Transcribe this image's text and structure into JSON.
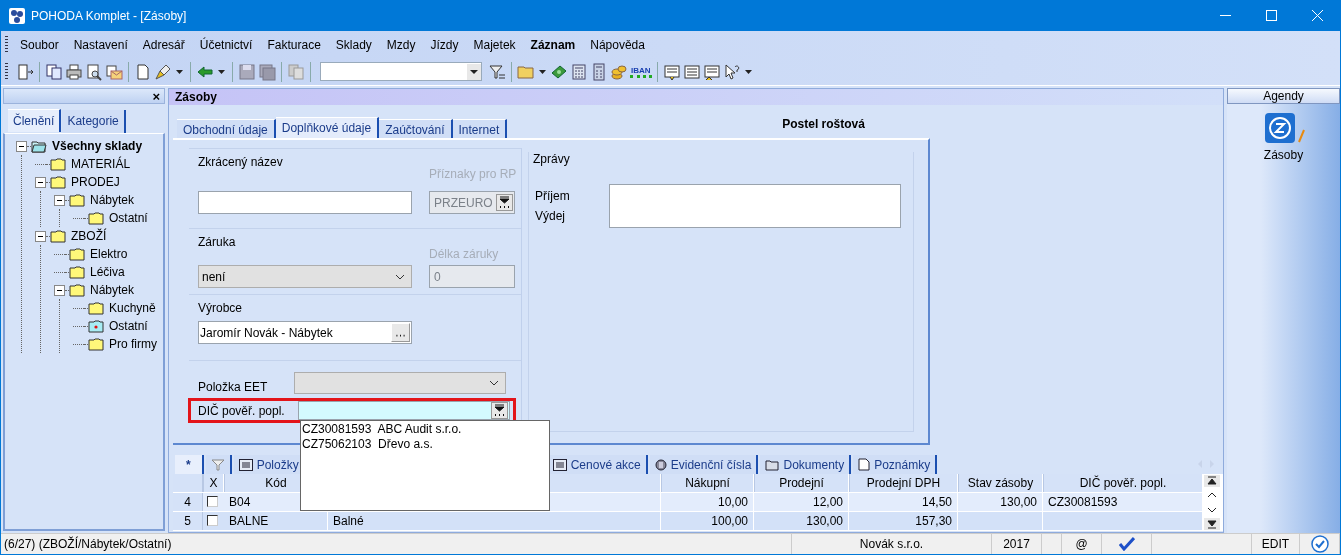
{
  "window": {
    "title": "POHODA Komplet - [Zásoby]"
  },
  "menu": [
    {
      "label": "Soubor",
      "bold": false
    },
    {
      "label": "Nastavení",
      "bold": false
    },
    {
      "label": "Adresář",
      "bold": false
    },
    {
      "label": "Účetnictví",
      "bold": false
    },
    {
      "label": "Fakturace",
      "bold": false
    },
    {
      "label": "Sklady",
      "bold": false
    },
    {
      "label": "Mzdy",
      "bold": false
    },
    {
      "label": "Jízdy",
      "bold": false
    },
    {
      "label": "Majetek",
      "bold": false
    },
    {
      "label": "Záznam",
      "bold": true
    },
    {
      "label": "Nápověda",
      "bold": false
    }
  ],
  "toolbar": {
    "iban_label": "IBAN"
  },
  "left_panel": {
    "close": "×",
    "tabs": [
      {
        "label": "Členění",
        "selected": true
      },
      {
        "label": "Kategorie",
        "selected": false
      }
    ],
    "tree": [
      {
        "label": "Všechny sklady",
        "selected": false,
        "expanded": true,
        "children": [
          {
            "label": "MATERIÁL",
            "selected": false
          },
          {
            "label": "PRODEJ",
            "selected": false,
            "expanded": true,
            "children": [
              {
                "label": "Nábytek",
                "selected": false,
                "expanded": true,
                "children": [
                  {
                    "label": "Ostatní",
                    "selected": false
                  }
                ]
              }
            ]
          },
          {
            "label": "ZBOŽÍ",
            "selected": false,
            "expanded": true,
            "children": [
              {
                "label": "Elektro",
                "selected": false
              },
              {
                "label": "Léčiva",
                "selected": false
              },
              {
                "label": "Nábytek",
                "selected": false,
                "expanded": true,
                "children": [
                  {
                    "label": "Kuchyně",
                    "selected": false
                  },
                  {
                    "label": "Ostatní",
                    "selected": true
                  },
                  {
                    "label": "Pro firmy",
                    "selected": false
                  }
                ]
              }
            ]
          }
        ]
      }
    ]
  },
  "agenda": {
    "title": "Zásoby",
    "item_name": "Postel roštová",
    "tabs": [
      {
        "label": "Obchodní údaje",
        "selected": false
      },
      {
        "label": "Doplňkové údaje",
        "selected": true
      },
      {
        "label": "Zaúčtování",
        "selected": false
      },
      {
        "label": "Internet",
        "selected": false
      }
    ],
    "short_name": {
      "label": "Zkrácený název"
    },
    "rp_flags": {
      "label": "Příznaky pro RP",
      "value": "PRZEURO",
      "disabled": true
    },
    "warranty": {
      "label": "Záruka",
      "value": "není"
    },
    "warranty_length": {
      "label": "Délka záruky",
      "value": "0",
      "disabled": true
    },
    "manufacturer": {
      "label": "Výrobce",
      "value": "Jaromír Novák - Nábytek"
    },
    "eet_item": {
      "label": "Položka EET",
      "disabled": true
    },
    "vat_payer": {
      "label": "DIČ pověř. popl.",
      "highlighted": true,
      "open": true,
      "options": [
        {
          "code": "CZ30081593",
          "name": "ABC Audit s.r.o."
        },
        {
          "code": "CZ75062103",
          "name": "Dřevo a.s."
        }
      ]
    },
    "messages": {
      "label": "Zprávy",
      "receipt": "Příjem",
      "issue": "Výdej"
    },
    "bottom_tabs_left": [
      {
        "label": "*",
        "kind": "new",
        "selected": true
      },
      {
        "kind": "filter",
        "selected": false
      },
      {
        "label": "Položky",
        "kind": "list",
        "selected": false
      }
    ],
    "bottom_tabs_right": [
      {
        "label": "Cenové akce",
        "kind": "list",
        "selected": false
      },
      {
        "label": "Evidenční čísla",
        "kind": "badge",
        "selected": false
      },
      {
        "label": "Dokumenty",
        "kind": "folder",
        "selected": false
      },
      {
        "label": "Poznámky",
        "kind": "note",
        "selected": false
      }
    ],
    "grid": {
      "check_column": "X",
      "code_column": "Kód",
      "columns": [
        "Nákupní",
        "Prodejní",
        "Prodejní DPH",
        "Stav zásoby",
        "DIČ pověř. popl."
      ],
      "rows": [
        {
          "number": "4",
          "checked": false,
          "selected": true,
          "code": "B04",
          "values": [
            "10,00",
            "12,00",
            "14,50",
            "130,00",
            "CZ30081593"
          ]
        },
        {
          "number": "5",
          "checked": false,
          "selected": false,
          "code": "BALNE",
          "name": "Balné",
          "values": [
            "100,00",
            "130,00",
            "157,30"
          ]
        }
      ]
    }
  },
  "right_panel": {
    "title": "Agendy",
    "items": [
      {
        "label": "Zásoby"
      }
    ]
  },
  "status_bar": {
    "record": "(6/27) (ZBOŽÍ/Nábytek/Ostatní)",
    "company": "Novák s.r.o.",
    "year": "2017",
    "at": "@",
    "mode": "EDIT"
  }
}
